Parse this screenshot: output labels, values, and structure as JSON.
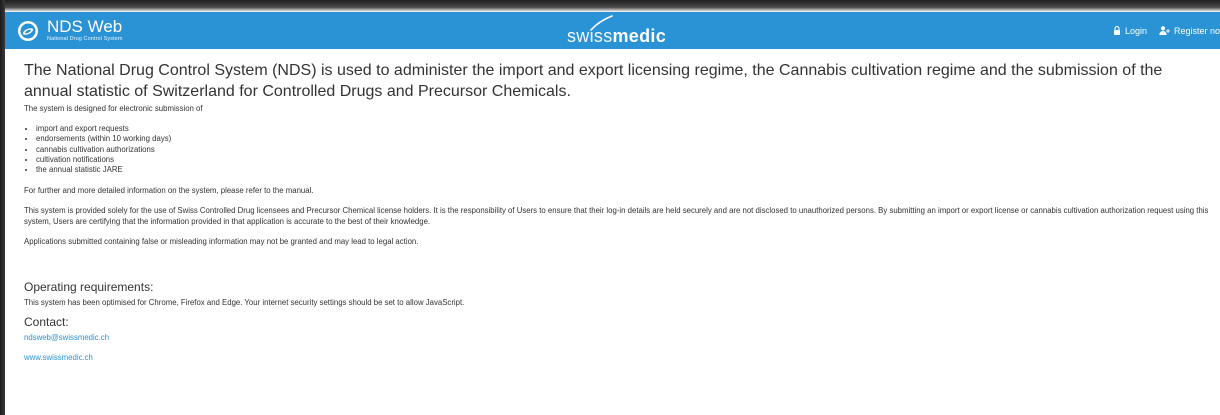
{
  "header": {
    "app_title": "NDS Web",
    "app_subtitle": "National Drug Control System",
    "center_logo": {
      "light_part": "swiss",
      "bold_part": "medic"
    },
    "login_label": "Login",
    "register_label": "Register no",
    "icons": [
      "lock-icon",
      "user-plus-icon"
    ],
    "background_color": "#2a93d6"
  },
  "main": {
    "headline": "The National Drug Control System (NDS) is used to administer the import and export licensing regime, the Cannabis cultivation regime and the submission of the annual statistic of Switzerland for Controlled Drugs and Precursor Chemicals.",
    "intro": "The system is designed for electronic submission of",
    "features": [
      "import and export requests",
      "endorsements (within 10 working days)",
      "cannabis cultivation authorizations",
      "cultivation notifications",
      "the annual statistic JARE"
    ],
    "manual_note": "For further and more detailed information on the system, please refer to the manual.",
    "usage_terms": "This system is provided solely for the use of Swiss Controlled Drug licensees and Precursor Chemical license holders. It is the responsibility of Users to ensure that their log-in details are held securely and are not disclosed to unauthorized persons. By submitting an import or export license or cannabis cultivation authorization request using this system, Users are certifying that the information provided in that application is accurate to the best of their knowledge.",
    "legal_warning": "Applications submitted containing false or misleading information may not be granted and may lead to legal action.",
    "requirements_heading": "Operating requirements:",
    "requirements_text": "This system has been optimised for Chrome, Firefox and Edge. Your internet security settings should be set to allow JavaScript.",
    "contact_heading": "Contact:",
    "contact_email": "ndsweb@swissmedic.ch",
    "contact_website": "www.swissmedic.ch",
    "link_color": "#2a93d6"
  }
}
